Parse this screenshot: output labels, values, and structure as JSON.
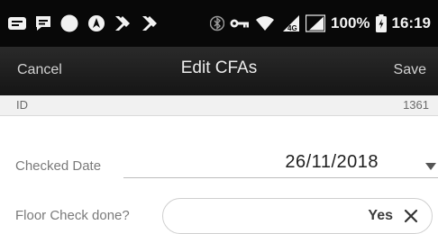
{
  "status_bar": {
    "battery_percent": "100%",
    "time": "16:19",
    "left_icons": [
      "message-icon",
      "chat-icon",
      "circle-icon",
      "navigation-icon",
      "arrow-icon",
      "arrow-icon"
    ],
    "right_icons": [
      "bluetooth-icon",
      "key-icon",
      "wifi-icon",
      "signal-icon",
      "signal-icon",
      "battery-icon"
    ]
  },
  "action_bar": {
    "cancel_label": "Cancel",
    "title": "Edit CFAs",
    "save_label": "Save"
  },
  "form": {
    "id_label": "ID",
    "id_value": "1361",
    "checked_date_label": "Checked Date",
    "checked_date_value": "26/11/2018",
    "floor_check_label": "Floor Check done?",
    "floor_check_value": "Yes"
  },
  "colors": {
    "status_bar_bg": "#080808",
    "action_bar_bg": "#1f1f1f",
    "id_row_bg": "#f1f1f1",
    "page_bg": "#ffffff"
  }
}
